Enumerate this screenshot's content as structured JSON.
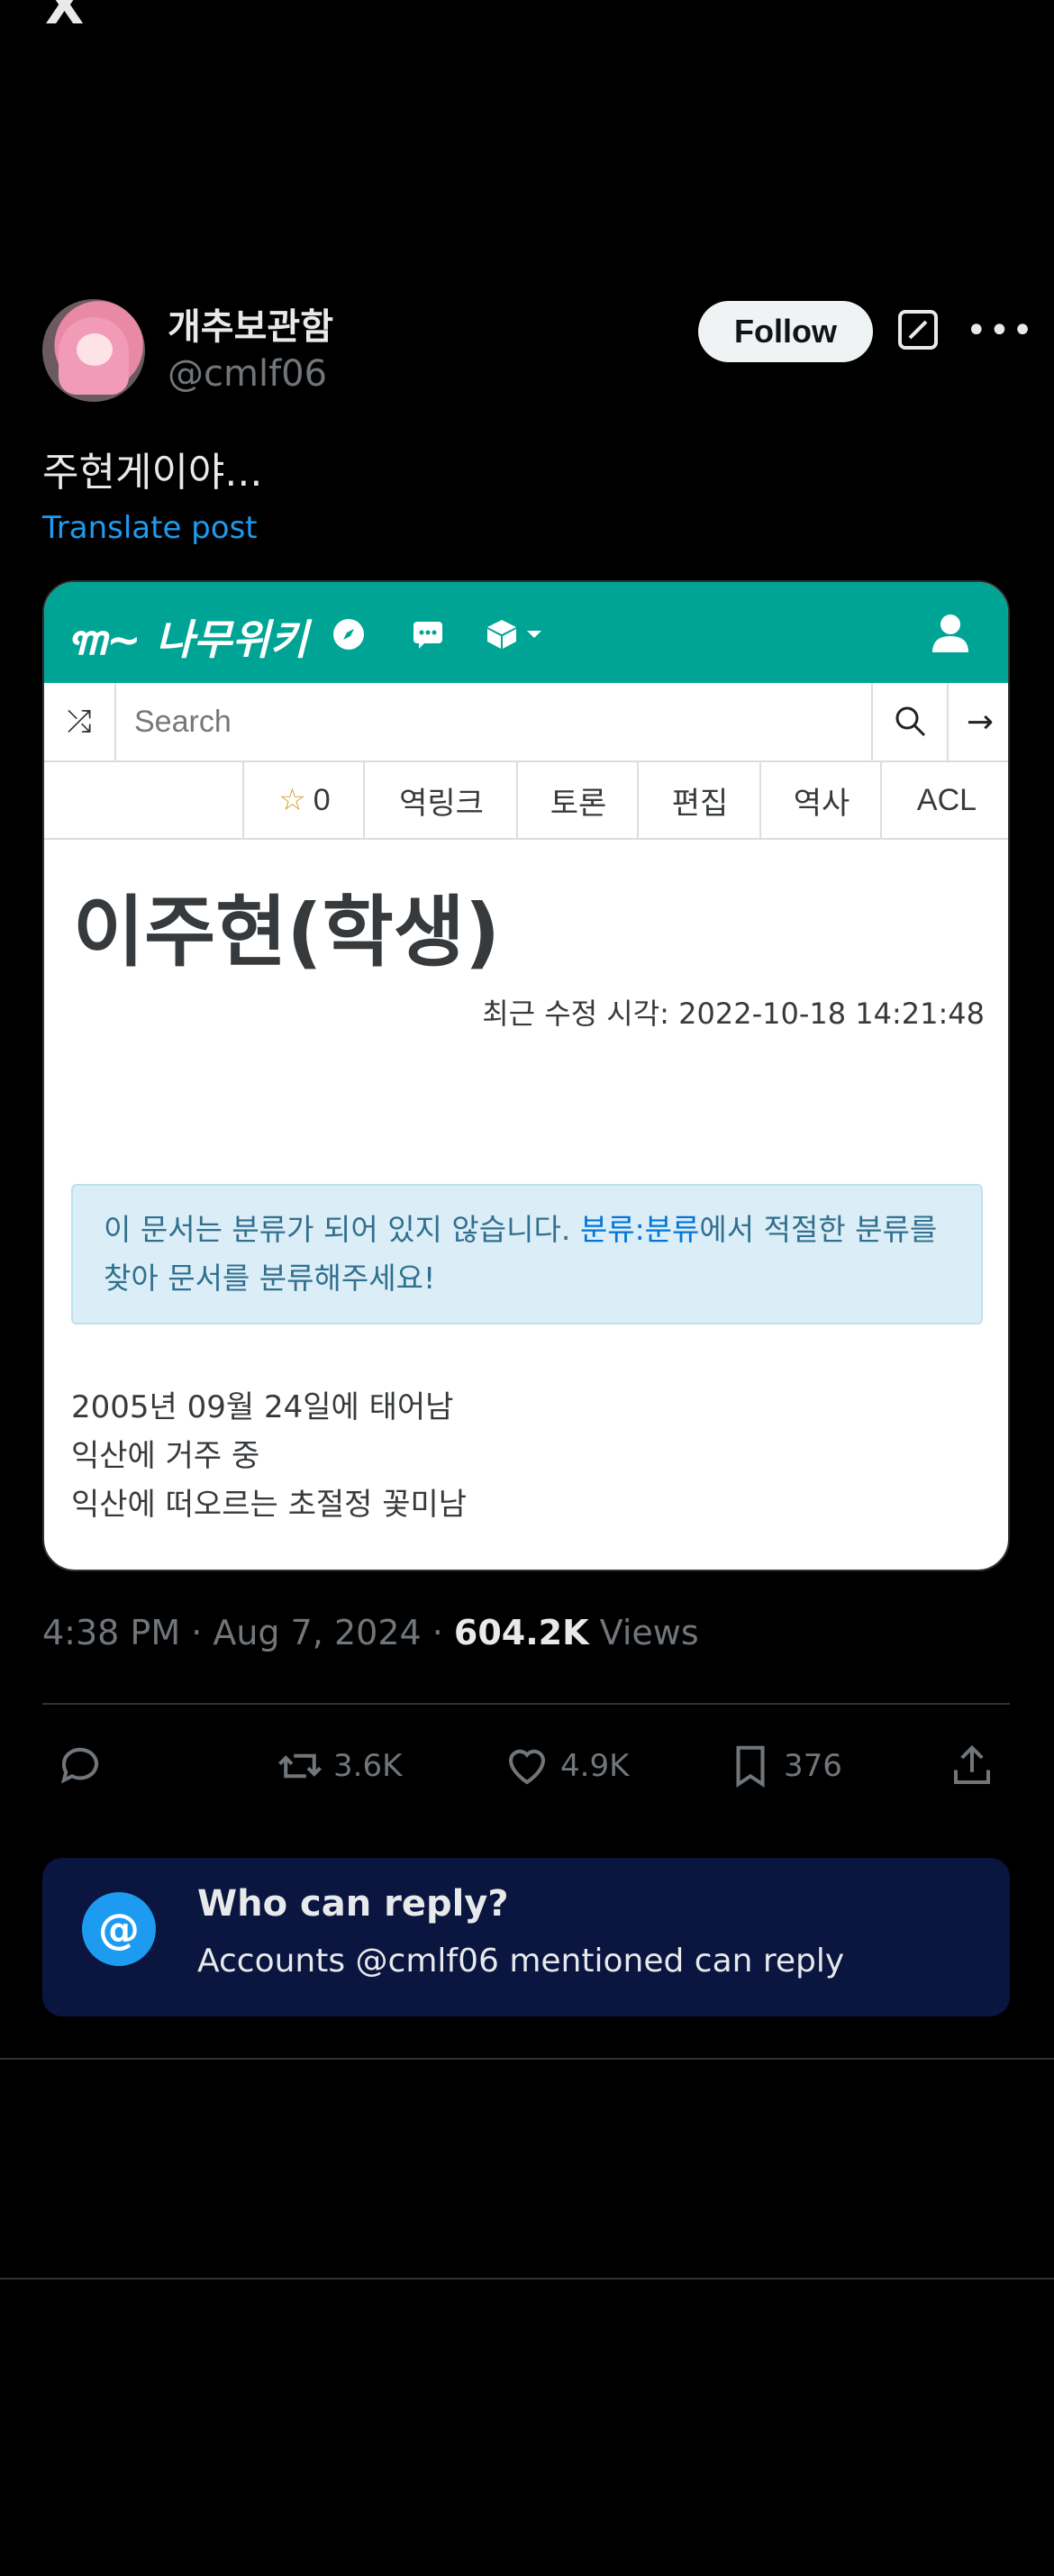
{
  "app": {
    "logo": "X"
  },
  "author": {
    "display_name": "개추보관함",
    "handle": "@cmlf06",
    "follow_label": "Follow"
  },
  "post": {
    "text": "주현게이야...",
    "translate_label": "Translate post"
  },
  "embedded_image": {
    "site_logo": "나무위키",
    "search_placeholder": "Search",
    "tabs": {
      "star_count": "0",
      "backlink": "역링크",
      "discussion": "토론",
      "edit": "편집",
      "history": "역사",
      "acl": "ACL"
    },
    "doc_title": "이주현(학생)",
    "modified": "최근 수정 시각: 2022-10-18 14:21:48",
    "notice_pre": "이 문서는 분류가 되어 있지 않습니다. ",
    "notice_link": "분류:분류",
    "notice_post": "에서 적절한 분류를 찾아 문서를 분류해주세요!",
    "body_lines": [
      "2005년 09월 24일에 태어남",
      "익산에 거주 중",
      "익산에 떠오르는 초절정 꽃미남"
    ]
  },
  "meta": {
    "time": "4:38 PM · Aug 7, 2024 · ",
    "views_count": "604.2K",
    "views_label": " Views"
  },
  "actions": {
    "reposts": "3.6K",
    "likes": "4.9K",
    "bookmarks": "376"
  },
  "reply_restriction": {
    "title": "Who can reply?",
    "subtitle": "Accounts @cmlf06 mentioned can reply",
    "icon": "@"
  },
  "colors": {
    "accent": "#1d9bf0",
    "namuwiki_green": "#00a495",
    "reply_box": "#0a1540"
  }
}
